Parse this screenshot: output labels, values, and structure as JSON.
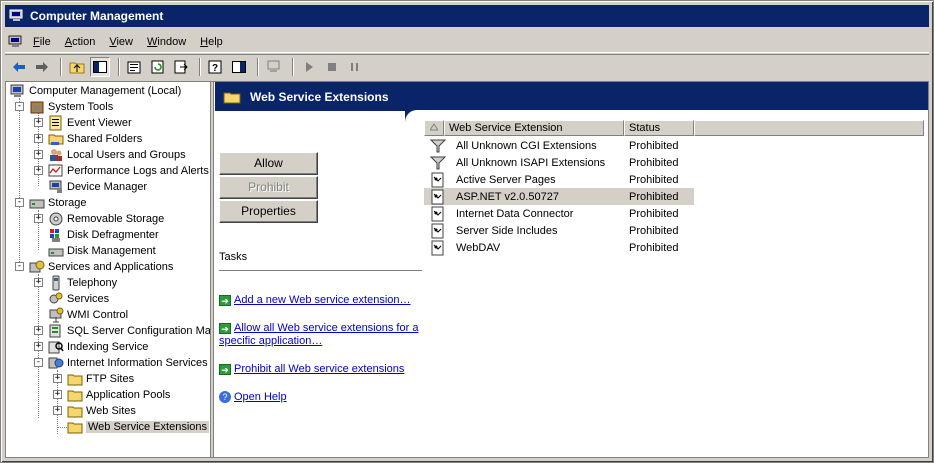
{
  "window": {
    "title": "Computer Management"
  },
  "menu": [
    "File",
    "Action",
    "View",
    "Window",
    "Help"
  ],
  "tree": {
    "root": "Computer Management (Local)",
    "system_tools": "System Tools",
    "event_viewer": "Event Viewer",
    "shared_folders": "Shared Folders",
    "local_users": "Local Users and Groups",
    "perf_logs": "Performance Logs and Alerts",
    "device_manager": "Device Manager",
    "storage": "Storage",
    "removable_storage": "Removable Storage",
    "disk_defrag": "Disk Defragmenter",
    "disk_mgmt": "Disk Management",
    "services_apps": "Services and Applications",
    "telephony": "Telephony",
    "services": "Services",
    "wmi": "WMI Control",
    "sql": "SQL Server Configuration Manager",
    "indexing": "Indexing Service",
    "iis": "Internet Information Services",
    "ftp": "FTP Sites",
    "app_pools": "Application Pools",
    "web_sites": "Web Sites",
    "wse": "Web Service Extensions"
  },
  "panel": {
    "title": "Web Service Extensions",
    "buttons": {
      "allow": "Allow",
      "prohibit": "Prohibit",
      "properties": "Properties"
    },
    "tasks_label": "Tasks",
    "tasks": {
      "add": "Add a new Web service extension…",
      "allow_all": "Allow all Web service extensions for a specific application…",
      "prohibit_all": "Prohibit all Web service extensions",
      "help": "Open Help"
    }
  },
  "list": {
    "headers": {
      "ext": "Web Service Extension",
      "status": "Status"
    },
    "rows": [
      {
        "name": "All Unknown CGI Extensions",
        "status": "Prohibited",
        "icon": "filter-icon"
      },
      {
        "name": "All Unknown ISAPI Extensions",
        "status": "Prohibited",
        "icon": "filter-icon"
      },
      {
        "name": "Active Server Pages",
        "status": "Prohibited",
        "icon": "extension-icon"
      },
      {
        "name": "ASP.NET v2.0.50727",
        "status": "Prohibited",
        "icon": "extension-icon"
      },
      {
        "name": "Internet Data Connector",
        "status": "Prohibited",
        "icon": "extension-icon"
      },
      {
        "name": "Server Side Includes",
        "status": "Prohibited",
        "icon": "extension-icon"
      },
      {
        "name": "WebDAV",
        "status": "Prohibited",
        "icon": "extension-icon"
      }
    ]
  }
}
